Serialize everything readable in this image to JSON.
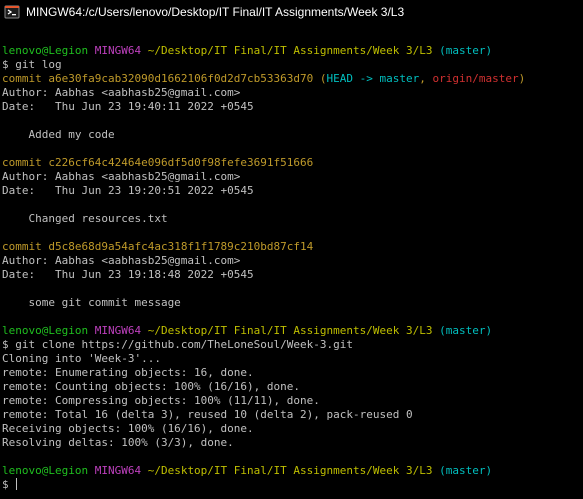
{
  "window": {
    "title": "MINGW64:/c/Users/lenovo/Desktop/IT Final/IT Assignments/Week 3/L3",
    "icon": "git-bash-icon"
  },
  "colors": {
    "background": "#000000",
    "prompt_user": "#1fbf1f",
    "prompt_shell": "#bf40bf",
    "prompt_path": "#bfbf00",
    "prompt_branch": "#00bfbf",
    "commit_hash": "#bf9a2a",
    "head_ref": "#00bfbf",
    "origin_ref": "#d03030",
    "text": "#c0c0c0"
  },
  "prompt": {
    "user": "lenovo@Legion",
    "shell": "MINGW64",
    "path": "~/Desktop/IT Final/IT Assignments/Week 3/L3",
    "branch": "(master)",
    "symbol": "$"
  },
  "commands": {
    "log": "git log",
    "clone": "git clone https://github.com/TheLoneSoul/Week-3.git"
  },
  "commits": [
    {
      "label": "commit",
      "hash": "a6e30fa9cab32090d1662106f0d2d7cb53363d70",
      "refs": {
        "open": "(",
        "head": "HEAD -> master",
        "sep": ", ",
        "origin": "origin/master",
        "close": ")"
      },
      "author": "Author: Aabhas <aabhasb25@gmail.com>",
      "date": "Date:   Thu Jun 23 19:40:11 2022 +0545",
      "message": "    Added my code"
    },
    {
      "label": "commit",
      "hash": "c226cf64c42464e096df5d0f98fefe3691f51666",
      "author": "Author: Aabhas <aabhasb25@gmail.com>",
      "date": "Date:   Thu Jun 23 19:20:51 2022 +0545",
      "message": "    Changed resources.txt"
    },
    {
      "label": "commit",
      "hash": "d5c8e68d9a54afc4ac318f1f1789c210bd87cf14",
      "author": "Author: Aabhas <aabhasb25@gmail.com>",
      "date": "Date:   Thu Jun 23 19:18:48 2022 +0545",
      "message": "    some git commit message"
    }
  ],
  "clone_output": [
    "Cloning into 'Week-3'...",
    "remote: Enumerating objects: 16, done.",
    "remote: Counting objects: 100% (16/16), done.",
    "remote: Compressing objects: 100% (11/11), done.",
    "remote: Total 16 (delta 3), reused 10 (delta 2), pack-reused 0",
    "Receiving objects: 100% (16/16), done.",
    "Resolving deltas: 100% (3/3), done."
  ]
}
